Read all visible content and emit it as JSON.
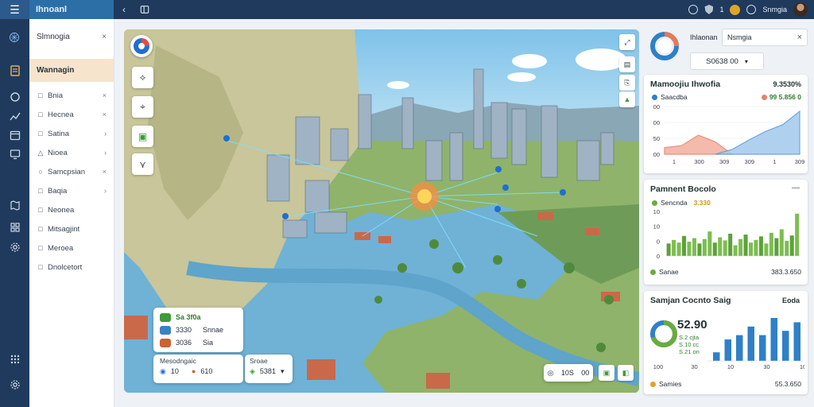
{
  "app": {
    "title": "Ihnoanl"
  },
  "topbar": {
    "badge_count": "1",
    "user_name": "Snmgia"
  },
  "sidebar": {
    "header": "Slmnogia",
    "active_item": "Wannagin",
    "items": [
      {
        "label": "Bnia",
        "icon": "square-icon",
        "chevron": "×"
      },
      {
        "label": "Hecnea",
        "icon": "square-icon",
        "chevron": "×"
      },
      {
        "label": "Satina",
        "icon": "square-icon",
        "chevron": "›"
      },
      {
        "label": "Nioea",
        "icon": "triangle-icon",
        "chevron": "›"
      },
      {
        "label": "Samcpsian",
        "icon": "circle-icon",
        "chevron": "×"
      },
      {
        "label": "Baqia",
        "icon": "square-icon",
        "chevron": "›"
      },
      {
        "label": "Neonea",
        "icon": "square-icon",
        "chevron": ""
      },
      {
        "label": "Mitsagjint",
        "icon": "square-icon",
        "chevron": ""
      },
      {
        "label": "Meroea",
        "icon": "square-icon",
        "chevron": ""
      },
      {
        "label": "Dnolcetort",
        "icon": "square-icon",
        "chevron": ""
      }
    ]
  },
  "map": {
    "legend_top": [
      {
        "value": "Sa 3f0a",
        "color": "#3f9a3a"
      },
      {
        "value": "3330",
        "label": "Snnae",
        "color": "#3b82c4"
      },
      {
        "value": "3036",
        "label": "Sia",
        "color": "#c9632f"
      }
    ],
    "legend_bottom": {
      "title": "Mesodngaic",
      "v1": "10",
      "v2": "610"
    },
    "legend_filter": {
      "title": "Sroae",
      "value": "5381"
    },
    "zoom_bar": {
      "a": "10S",
      "b": "00"
    }
  },
  "search": {
    "label": "Ihlaonan",
    "value": "Nsmgia",
    "dropdown": "S0638 00"
  },
  "panel_main": {
    "title": "Mamoojiu Ihwofia",
    "value": "9.3530%",
    "legend_a": "Saacdba",
    "legend_b": "99 5.856 0",
    "y_ticks": [
      "00",
      "00",
      "50",
      "00"
    ],
    "x_ticks": [
      "1",
      "300",
      "309",
      "309",
      "1",
      "309"
    ]
  },
  "panel_perf": {
    "title": "Pamnent Bocolo",
    "sub": "Sencnda",
    "sub_value": "3.330",
    "y_ticks": [
      "10",
      "10",
      "0",
      "0"
    ],
    "footer": "Sanae",
    "footer_value": "383.3.650"
  },
  "panel_stats": {
    "title": "Samjan Cocnto Saig",
    "badge": "Eoda",
    "big_value": "52.90",
    "lines": [
      "S.2 cjta",
      "S.10 cc",
      "S.21 on"
    ],
    "x_ticks": [
      "100",
      "30",
      "10",
      "30",
      "10"
    ],
    "footer": "Samies",
    "footer_value": "55.3.650"
  },
  "chart_data": [
    {
      "type": "area",
      "title": "Mamoojiu Ihwofia",
      "x": [
        "1",
        "300",
        "309",
        "309",
        "1",
        "309"
      ],
      "series": [
        {
          "name": "Saacdba",
          "values": [
            14,
            18,
            40,
            26,
            0,
            0,
            0,
            0,
            0
          ]
        },
        {
          "name": "99 5.856 0",
          "values": [
            0,
            0,
            0,
            0,
            10,
            30,
            48,
            62,
            90
          ]
        }
      ],
      "ylabels": [
        "00",
        "00",
        "50",
        "00"
      ]
    },
    {
      "type": "bar",
      "title": "Pamnent Bocolo",
      "values": [
        28,
        36,
        30,
        45,
        32,
        40,
        28,
        38,
        55,
        30,
        42,
        35,
        50,
        24,
        38,
        48,
        30,
        36,
        44,
        28,
        52,
        40,
        60,
        34,
        46,
        95
      ],
      "ylabels": [
        "10",
        "10",
        "0",
        "0"
      ]
    },
    {
      "type": "bar",
      "title": "Samjan Cocnto Saig",
      "categories": [
        "100",
        "30",
        "10",
        "30",
        "10"
      ],
      "values": [
        2,
        5,
        6,
        8,
        6,
        10,
        7,
        9
      ],
      "donut": {
        "value": "52.90",
        "green_fraction": 0.7
      }
    }
  ]
}
